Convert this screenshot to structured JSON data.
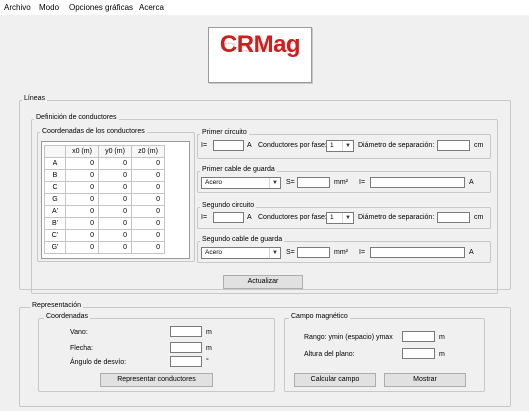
{
  "menu": [
    "Archivo",
    "Modo",
    "Opciones gráficas",
    "Acerca"
  ],
  "logo": "CRMag",
  "lineas": {
    "title": "Líneas",
    "definicion_title": "Definición de conductores",
    "coordenadas_title": "Coordenadas de los conductores",
    "table": {
      "headers": [
        "x0 (m)",
        "y0 (m)",
        "z0 (m)"
      ],
      "rows": [
        {
          "label": "A",
          "x0": "0",
          "y0": "0",
          "z0": "0"
        },
        {
          "label": "B",
          "x0": "0",
          "y0": "0",
          "z0": "0"
        },
        {
          "label": "C",
          "x0": "0",
          "y0": "0",
          "z0": "0"
        },
        {
          "label": "G",
          "x0": "0",
          "y0": "0",
          "z0": "0"
        },
        {
          "label": "A'",
          "x0": "0",
          "y0": "0",
          "z0": "0"
        },
        {
          "label": "B'",
          "x0": "0",
          "y0": "0",
          "z0": "0"
        },
        {
          "label": "C'",
          "x0": "0",
          "y0": "0",
          "z0": "0"
        },
        {
          "label": "G'",
          "x0": "0",
          "y0": "0",
          "z0": "0"
        }
      ]
    },
    "primer_circuito": {
      "title": "Primer circuito",
      "i_label": "I=",
      "i_unit": "A",
      "cond_label": "Conductores por fase:",
      "cond_value": "1",
      "diam_label": "Diámetro de separación:",
      "diam_unit": "cm"
    },
    "primer_cable": {
      "title": "Primer cable de guarda",
      "material": "Acero",
      "s_label": "S=",
      "s_unit": "mm²",
      "i_label": "I=",
      "i_unit": "A"
    },
    "segundo_circuito": {
      "title": "Segundo circuito",
      "i_label": "I=",
      "i_unit": "A",
      "cond_label": "Conductores por fase:",
      "cond_value": "1",
      "diam_label": "Diámetro de separación:",
      "diam_unit": "cm"
    },
    "segundo_cable": {
      "title": "Segundo cable de guarda",
      "material": "Acero",
      "s_label": "S=",
      "s_unit": "mm²",
      "i_label": "I=",
      "i_unit": "A"
    },
    "actualizar": "Actualizar"
  },
  "representacion": {
    "title": "Representación",
    "coordenadas": {
      "title": "Coordenadas",
      "vano": "Vano:",
      "vano_unit": "m",
      "flecha": "Flecha:",
      "flecha_unit": "m",
      "angulo": "Ángulo de desvío:",
      "angulo_unit": "°",
      "button": "Representar conductores"
    },
    "campo": {
      "title": "Campo magnético",
      "rango": "Rango: ymin (espacio) ymax",
      "rango_unit": "m",
      "altura": "Altura del plano:",
      "altura_unit": "m",
      "calcular": "Calcular campo",
      "mostrar": "Mostrar"
    }
  }
}
